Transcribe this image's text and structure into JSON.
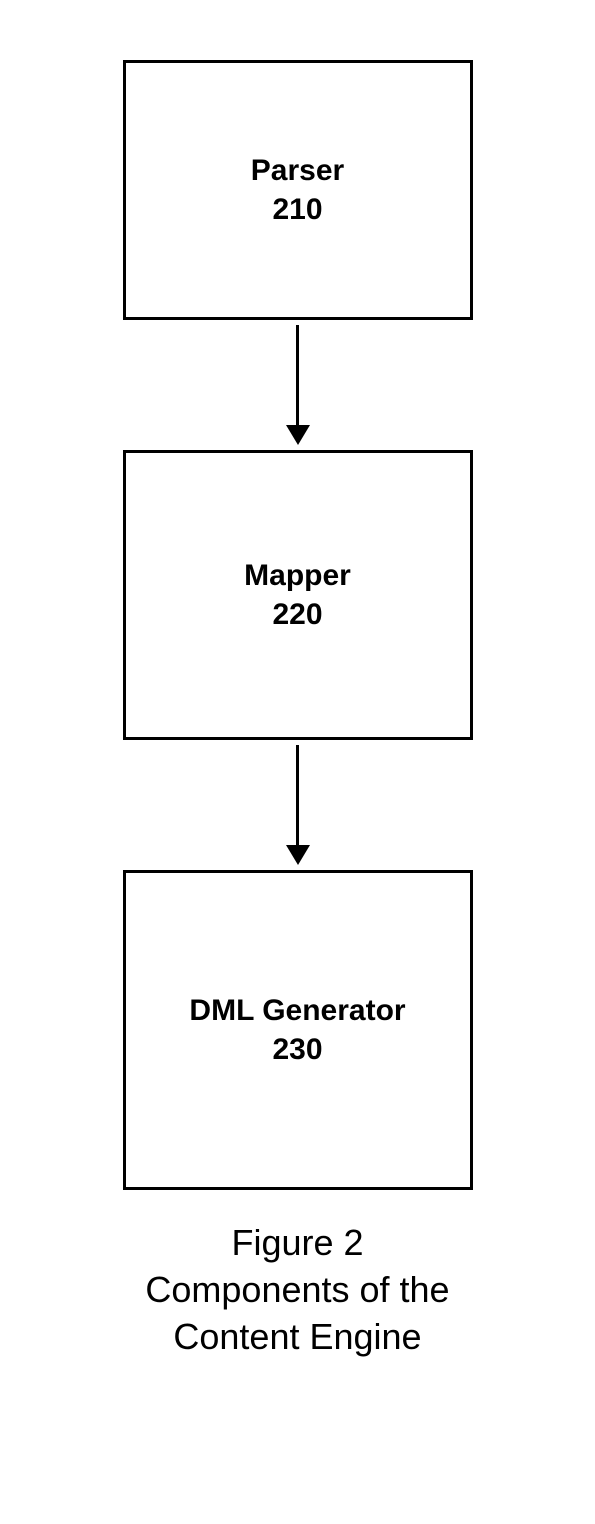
{
  "boxes": [
    {
      "label": "Parser",
      "number": "210"
    },
    {
      "label": "Mapper",
      "number": "220"
    },
    {
      "label": "DML Generator",
      "number": "230"
    }
  ],
  "caption": {
    "line1": "Figure 2",
    "line2": "Components of the",
    "line3": "Content Engine"
  }
}
